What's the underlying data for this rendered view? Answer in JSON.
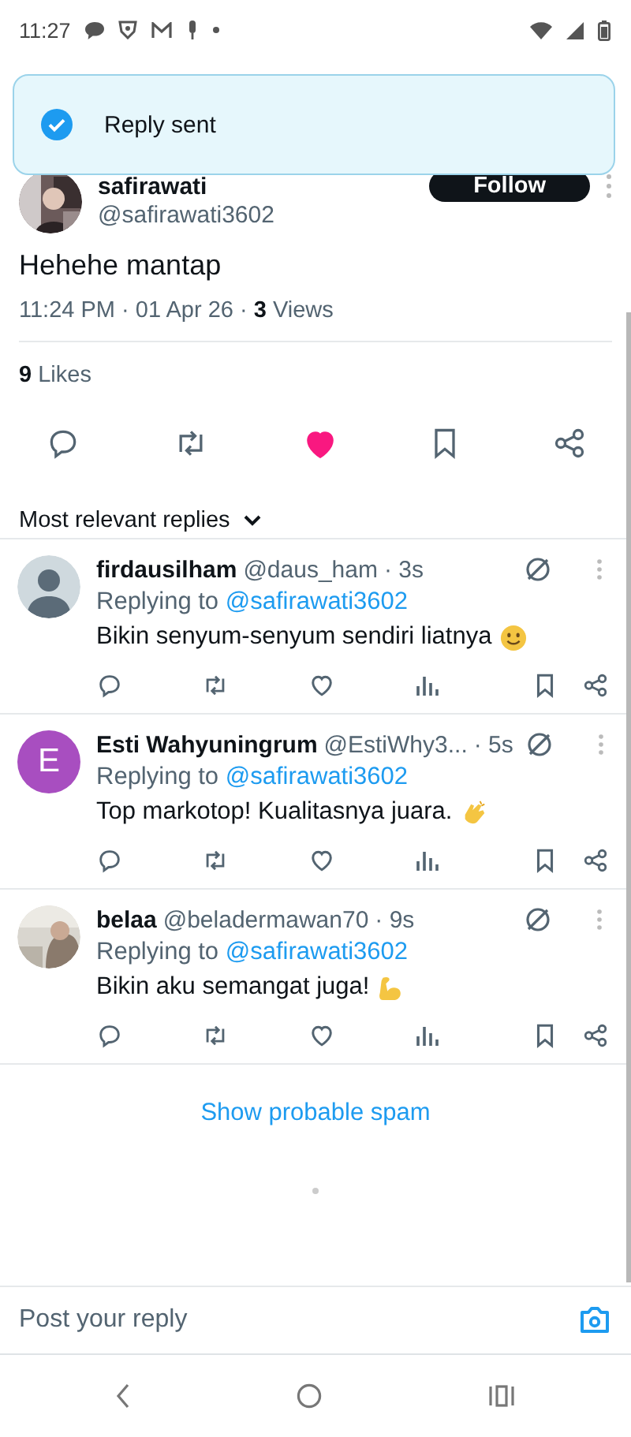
{
  "status_bar": {
    "time": "11:27"
  },
  "toast": {
    "text": "Reply sent"
  },
  "post": {
    "author": "safirawati",
    "handle": "@safirawati3602",
    "follow_label": "Follow",
    "text": "Hehehe mantap",
    "time": "11:24 PM · 01 Apr 26 · ",
    "views_count": "3",
    "views_label": "Views",
    "likes_count": "9",
    "likes_label": "Likes",
    "liked": true
  },
  "sort": {
    "label": "Most relevant replies"
  },
  "replies": [
    {
      "name": "firdausilham",
      "handle": "@daus_ham",
      "age": "· 3s",
      "avatar": {
        "kind": "silhouette"
      },
      "replying_label": "Replying to",
      "replying_to": "@safirawati3602",
      "text": "Bikin senyum-senyum sendiri liatnya",
      "liked": false
    },
    {
      "name": "Esti Wahyuningrum",
      "handle": "@EstiWhy3...",
      "age": "· 5s",
      "avatar": {
        "kind": "letter",
        "letter": "E",
        "color": "#a84ec0"
      },
      "replying_label": "Replying to",
      "replying_to": "@safirawati3602",
      "text": "Top markotop! Kualitasnya juara.",
      "liked": false
    },
    {
      "name": "belaa",
      "handle": "@beladermawan70",
      "age": "· 9s",
      "replying_label": "Replying to",
      "replying_to": "@safirawati3602",
      "text": "Bikin aku semangat juga!",
      "liked": false
    }
  ],
  "spam_link": "Show probable spam",
  "composer": {
    "placeholder": "Post your reply"
  }
}
